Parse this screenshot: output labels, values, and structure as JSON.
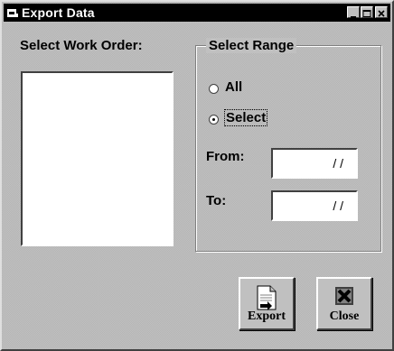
{
  "window": {
    "title": "Export Data",
    "title_icon": "app-icon",
    "controls": [
      "minimize-icon",
      "maximize-icon",
      "close-icon"
    ]
  },
  "work_order": {
    "label": "Select Work Order:",
    "items": []
  },
  "range": {
    "group_title": "Select Range",
    "options": [
      {
        "label": "All",
        "selected": false
      },
      {
        "label": "Select",
        "selected": true
      }
    ],
    "from_label": "From:",
    "from_value": "/ /",
    "to_label": "To:",
    "to_value": "/ /"
  },
  "buttons": {
    "export_label": "Export",
    "export_icon": "document-export-icon",
    "close_label": "Close",
    "close_icon": "close-x-icon"
  },
  "colors": {
    "face": "#c0c0c0",
    "titlebar": "#000000",
    "field": "#ffffff"
  }
}
